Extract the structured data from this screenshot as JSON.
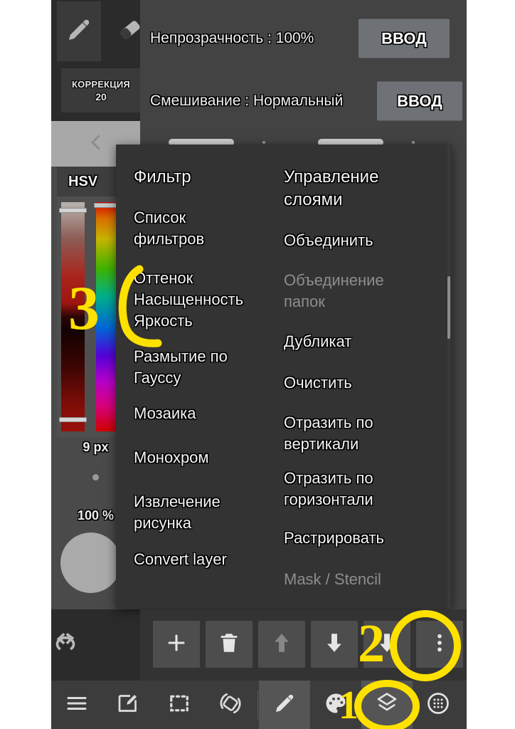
{
  "app": {
    "name": "ibis-paint-x",
    "accent_yellow": "#FFE100",
    "panel_bg": "#333333",
    "workarea_bg": "#434343",
    "toolbar_bg": "#2b2b2b"
  },
  "toolstrip": {
    "tools": [
      {
        "name": "pencil-tool",
        "icon": "pencil-icon",
        "selected": true
      },
      {
        "name": "eraser-tool",
        "icon": "eraser-icon",
        "selected": false
      }
    ]
  },
  "correction": {
    "label": "КОРРЕКЦИЯ",
    "value": "20"
  },
  "collapse": {
    "icon": "chevron-left-icon"
  },
  "color_panel": {
    "mode_label": "HSV",
    "brush_size": "9 px",
    "opacity": "100 %",
    "sliders": [
      {
        "name": "saturation-value-slider",
        "top_knob": "6%",
        "bottom_knob": "96%"
      },
      {
        "name": "hue-slider",
        "top_knob": "1%"
      }
    ]
  },
  "history": {
    "undo": "undo-icon",
    "redo": "redo-icon"
  },
  "settings_rows": [
    {
      "label": "Непрозрачность : 100%",
      "button": "ВВОД"
    },
    {
      "label": "Смешивание : Нормальный",
      "button": "ВВОД"
    }
  ],
  "popup_menu": {
    "columns": [
      {
        "name": "filter-column",
        "items": [
          {
            "label": "Фильтр",
            "header": true,
            "disabled": false
          },
          {
            "label": "Список\nфильтров",
            "header": false,
            "disabled": false
          },
          {
            "label": "Оттенок\nНасыщенность\nЯркость",
            "header": false,
            "disabled": false
          },
          {
            "label": "Размытие по\nГауссу",
            "header": false,
            "disabled": false
          },
          {
            "label": "Мозаика",
            "header": false,
            "disabled": false
          },
          {
            "label": "Монохром",
            "header": false,
            "disabled": false
          },
          {
            "label": "Извлечение\nрисунка",
            "header": false,
            "disabled": false
          },
          {
            "label": "Convert layer",
            "header": false,
            "disabled": false
          }
        ]
      },
      {
        "name": "layer-management-column",
        "items": [
          {
            "label": "Управление\nслоями",
            "header": true,
            "disabled": false
          },
          {
            "label": "Объединить",
            "header": false,
            "disabled": false
          },
          {
            "label": "Объединение\nпапок",
            "header": false,
            "disabled": true
          },
          {
            "label": "Дубликат",
            "header": false,
            "disabled": false
          },
          {
            "label": "Очистить",
            "header": false,
            "disabled": false
          },
          {
            "label": "Отразить по\nвертикали",
            "header": false,
            "disabled": false
          },
          {
            "label": "Отразить по\nгоризонтали",
            "header": false,
            "disabled": false
          },
          {
            "label": "Растрировать",
            "header": false,
            "disabled": false
          },
          {
            "label": "Mask / Stencil",
            "header": false,
            "disabled": true
          }
        ]
      }
    ]
  },
  "layer_actions": [
    {
      "name": "add-layer-button",
      "icon": "plus-icon",
      "disabled": false
    },
    {
      "name": "delete-layer-button",
      "icon": "trash-icon",
      "disabled": false
    },
    {
      "name": "move-layer-up-button",
      "icon": "arrow-up-icon",
      "disabled": true
    },
    {
      "name": "move-layer-down-button",
      "icon": "arrow-down-icon",
      "disabled": false
    },
    {
      "name": "merge-down-button",
      "icon": "arrow-down-icon",
      "disabled": false
    },
    {
      "name": "layer-more-menu-button",
      "icon": "kebab-menu-icon",
      "disabled": false
    }
  ],
  "nav_bar": [
    {
      "name": "menu-button",
      "icon": "hamburger-icon",
      "active": false
    },
    {
      "name": "canvas-edit-button",
      "icon": "compose-icon",
      "active": false
    },
    {
      "name": "selection-button",
      "icon": "marquee-icon",
      "active": false
    },
    {
      "name": "transform-button",
      "icon": "rotate-icon",
      "active": false
    },
    {
      "name": "brush-button",
      "icon": "pencil-icon",
      "active": true
    },
    {
      "name": "palette-button",
      "icon": "palette-icon",
      "active": false
    },
    {
      "name": "layers-button",
      "icon": "layers-icon",
      "active": false
    },
    {
      "name": "material-button",
      "icon": "dotted-circle-icon",
      "active": false
    }
  ],
  "annotations": [
    {
      "name": "annotation-step-1",
      "label": "1",
      "kind": "number"
    },
    {
      "name": "annotation-step-2",
      "label": "2",
      "kind": "number"
    },
    {
      "name": "annotation-step-3",
      "label": "3",
      "kind": "number"
    },
    {
      "name": "annotation-circle-layers",
      "label": "",
      "kind": "circle"
    },
    {
      "name": "annotation-circle-more-menu",
      "label": "",
      "kind": "circle"
    },
    {
      "name": "annotation-bracket-hsl",
      "label": "",
      "kind": "bracket"
    }
  ]
}
